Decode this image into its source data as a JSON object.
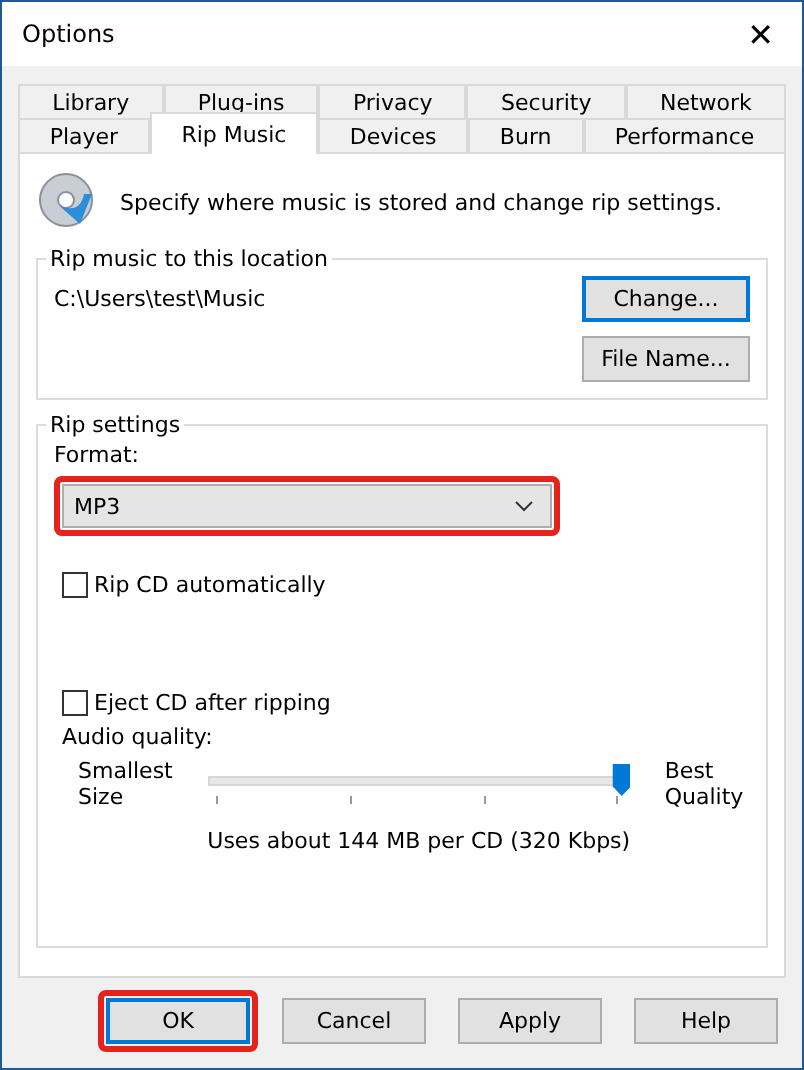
{
  "window": {
    "title": "Options",
    "close": "✕"
  },
  "tab_rows": [
    [
      {
        "label": "Library",
        "selected": false
      },
      {
        "label": "Plug-ins",
        "selected": false
      },
      {
        "label": "Privacy",
        "selected": false
      },
      {
        "label": "Security",
        "selected": false
      },
      {
        "label": "Network",
        "selected": false
      }
    ],
    [
      {
        "label": "Player",
        "selected": false
      },
      {
        "label": "Rip Music",
        "selected": true
      },
      {
        "label": "Devices",
        "selected": false
      },
      {
        "label": "Burn",
        "selected": false
      },
      {
        "label": "Performance",
        "selected": false
      }
    ]
  ],
  "intro": "Specify where music is stored and change rip settings.",
  "location": {
    "legend": "Rip music to this location",
    "path": "C:\\Users\\test\\Music",
    "buttons": [
      {
        "label": "Change...",
        "focused": true
      },
      {
        "label": "File Name...",
        "focused": false
      }
    ]
  },
  "rip_settings": {
    "legend": "Rip settings",
    "format_label": "Format:",
    "format": {
      "value": "MP3",
      "highlighted": true
    },
    "checkboxes": [
      {
        "label": "Rip CD automatically",
        "checked": false
      },
      {
        "label": "Eject CD after ripping",
        "checked": false
      }
    ],
    "quality_label": "Audio quality:",
    "min_label": "Smallest\nSize",
    "max_label": "Best\nQuality",
    "level": 1,
    "reading": "Uses about 144 MB per CD (320 Kbps)"
  },
  "buttons": [
    {
      "label": "OK",
      "focused": true,
      "highlighted": true
    },
    {
      "label": "Cancel",
      "focused": false,
      "highlighted": false
    },
    {
      "label": "Apply",
      "focused": false,
      "highlighted": false
    },
    {
      "label": "Help",
      "focused": false,
      "highlighted": false
    }
  ]
}
